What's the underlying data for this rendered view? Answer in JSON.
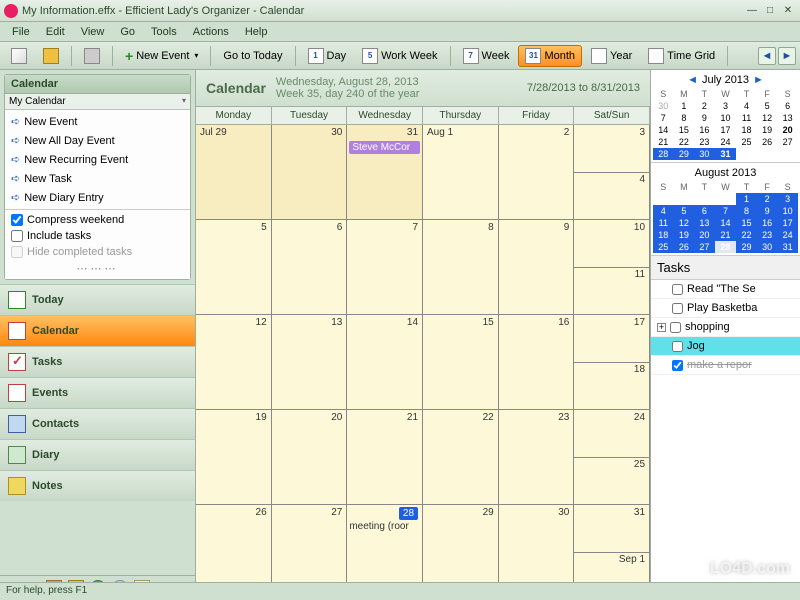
{
  "window": {
    "title": "My Information.effx - Efficient Lady's Organizer - Calendar"
  },
  "menu": [
    "File",
    "Edit",
    "View",
    "Go",
    "Tools",
    "Actions",
    "Help"
  ],
  "toolbar": {
    "new_event": "New Event",
    "go_today": "Go to Today",
    "day": "Day",
    "work_week": "Work Week",
    "week": "Week",
    "month": "Month",
    "year": "Year",
    "time_grid": "Time Grid",
    "day_num": "1",
    "ww_num": "5",
    "week_num": "7",
    "month_num": "31"
  },
  "sidebar": {
    "panel_title": "Calendar",
    "my_calendar": "My Calendar",
    "quick": [
      "New Event",
      "New All Day Event",
      "New Recurring Event",
      "New Task",
      "New Diary Entry"
    ],
    "compress": "Compress weekend",
    "include_tasks": "Include tasks",
    "hide_completed": "Hide completed tasks",
    "nav": [
      "Today",
      "Calendar",
      "Tasks",
      "Events",
      "Contacts",
      "Diary",
      "Notes"
    ]
  },
  "calendar": {
    "title": "Calendar",
    "date_line": "Wednesday, August 28, 2013",
    "week_line": "Week 35, day 240 of the year",
    "range": "7/28/2013 to 8/31/2013",
    "day_headers": [
      "Monday",
      "Tuesday",
      "Wednesday",
      "Thursday",
      "Friday",
      "Sat/Sun"
    ],
    "weeks": [
      {
        "cells": [
          {
            "label": "Jul 29",
            "out": true,
            "first": true
          },
          {
            "label": "30",
            "out": true
          },
          {
            "label": "31",
            "out": true,
            "event": {
              "text": "Steve McCor",
              "cls": "purple"
            }
          },
          {
            "label": "Aug 1",
            "first": true
          },
          {
            "label": "2"
          },
          {
            "label": "3",
            "weekend2": "4"
          }
        ]
      },
      {
        "cells": [
          {
            "label": "5"
          },
          {
            "label": "6"
          },
          {
            "label": "7"
          },
          {
            "label": "8"
          },
          {
            "label": "9"
          },
          {
            "label": "10",
            "weekend2": "11"
          }
        ]
      },
      {
        "cells": [
          {
            "label": "12"
          },
          {
            "label": "13"
          },
          {
            "label": "14"
          },
          {
            "label": "15"
          },
          {
            "label": "16"
          },
          {
            "label": "17",
            "weekend2": "18"
          }
        ]
      },
      {
        "cells": [
          {
            "label": "19"
          },
          {
            "label": "20"
          },
          {
            "label": "21"
          },
          {
            "label": "22"
          },
          {
            "label": "23"
          },
          {
            "label": "24",
            "weekend2": "25"
          }
        ]
      },
      {
        "cells": [
          {
            "label": "26"
          },
          {
            "label": "27"
          },
          {
            "label": "28",
            "today": true,
            "text_below": "meeting (roor"
          },
          {
            "label": "29"
          },
          {
            "label": "30"
          },
          {
            "label": "31",
            "weekend2": "Sep 1"
          }
        ]
      }
    ]
  },
  "mini_cals": [
    {
      "title": "July 2013",
      "dow": [
        "S",
        "M",
        "T",
        "W",
        "T",
        "F",
        "S"
      ],
      "rows": [
        [
          {
            "n": "30",
            "g": true
          },
          {
            "n": "1"
          },
          {
            "n": "2"
          },
          {
            "n": "3"
          },
          {
            "n": "4"
          },
          {
            "n": "5"
          },
          {
            "n": "6"
          }
        ],
        [
          {
            "n": "7"
          },
          {
            "n": "8"
          },
          {
            "n": "9"
          },
          {
            "n": "10"
          },
          {
            "n": "11"
          },
          {
            "n": "12"
          },
          {
            "n": "13"
          }
        ],
        [
          {
            "n": "14"
          },
          {
            "n": "15"
          },
          {
            "n": "16"
          },
          {
            "n": "17"
          },
          {
            "n": "18"
          },
          {
            "n": "19"
          },
          {
            "n": "20",
            "b": true
          }
        ],
        [
          {
            "n": "21"
          },
          {
            "n": "22"
          },
          {
            "n": "23"
          },
          {
            "n": "24"
          },
          {
            "n": "25"
          },
          {
            "n": "26"
          },
          {
            "n": "27"
          }
        ],
        [
          {
            "n": "28",
            "s": true
          },
          {
            "n": "29",
            "s": true
          },
          {
            "n": "30",
            "s": true
          },
          {
            "n": "31",
            "s": true,
            "b": true
          },
          {
            "n": ""
          },
          {
            "n": ""
          },
          {
            "n": ""
          }
        ]
      ]
    },
    {
      "title": "August 2013",
      "dow": [
        "S",
        "M",
        "T",
        "W",
        "T",
        "F",
        "S"
      ],
      "rows": [
        [
          {
            "n": ""
          },
          {
            "n": ""
          },
          {
            "n": ""
          },
          {
            "n": ""
          },
          {
            "n": "1",
            "s": true
          },
          {
            "n": "2",
            "s": true
          },
          {
            "n": "3",
            "s": true
          }
        ],
        [
          {
            "n": "4",
            "s": true
          },
          {
            "n": "5",
            "s": true
          },
          {
            "n": "6",
            "s": true
          },
          {
            "n": "7",
            "s": true
          },
          {
            "n": "8",
            "s": true
          },
          {
            "n": "9",
            "s": true
          },
          {
            "n": "10",
            "s": true
          }
        ],
        [
          {
            "n": "11",
            "s": true
          },
          {
            "n": "12",
            "s": true
          },
          {
            "n": "13",
            "s": true
          },
          {
            "n": "14",
            "s": true
          },
          {
            "n": "15",
            "s": true
          },
          {
            "n": "16",
            "s": true
          },
          {
            "n": "17",
            "s": true
          }
        ],
        [
          {
            "n": "18",
            "s": true
          },
          {
            "n": "19",
            "s": true
          },
          {
            "n": "20",
            "s": true
          },
          {
            "n": "21",
            "s": true
          },
          {
            "n": "22",
            "s": true
          },
          {
            "n": "23",
            "s": true
          },
          {
            "n": "24",
            "s": true
          }
        ],
        [
          {
            "n": "25",
            "s": true
          },
          {
            "n": "26",
            "s": true
          },
          {
            "n": "27",
            "s": true
          },
          {
            "n": "28",
            "s": true,
            "b": true,
            "today": true
          },
          {
            "n": "29",
            "s": true
          },
          {
            "n": "30",
            "s": true
          },
          {
            "n": "31",
            "s": true
          }
        ]
      ]
    }
  ],
  "tasks": {
    "title": "Tasks",
    "items": [
      {
        "text": "Read \"The Se",
        "done": false
      },
      {
        "text": "Play Basketba",
        "done": false
      },
      {
        "text": "shopping",
        "done": false,
        "expandable": true
      },
      {
        "text": "Jog",
        "done": false,
        "hl": true
      },
      {
        "text": "make a repor",
        "done": true
      }
    ]
  },
  "status": "For help, press F1",
  "watermark": "LO4D.com"
}
